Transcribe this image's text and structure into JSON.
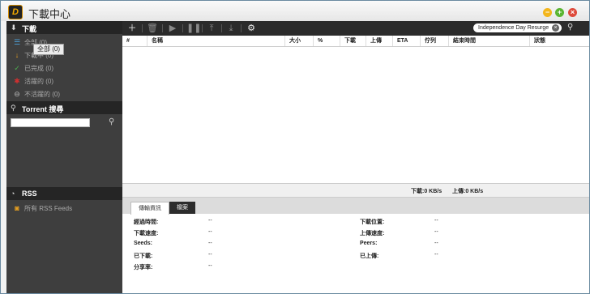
{
  "window": {
    "title": "下載中心",
    "app_icon_letter": "D",
    "controls": {
      "minimize": "−",
      "maximize": "+",
      "close": "×"
    }
  },
  "sidebar": {
    "download_header": "下載",
    "download_items": [
      {
        "label": "全部 (0)",
        "icon": "list-icon",
        "color": "#4da0d8"
      },
      {
        "label": "下載中 (0)",
        "icon": "download-arrow-icon",
        "color": "#e8a020"
      },
      {
        "label": "已完成 (0)",
        "icon": "checkmark-icon",
        "color": "#4cb050"
      },
      {
        "label": "活躍的 (0)",
        "icon": "active-icon",
        "color": "#d03030"
      },
      {
        "label": "不活躍的 (0)",
        "icon": "inactive-icon",
        "color": "#bbbbbb"
      }
    ],
    "tooltip": "全部 (0)",
    "search_header": "Torrent 搜尋",
    "search_value": "",
    "rss_header": "RSS",
    "rss_item": "所有 RSS Feeds"
  },
  "toolbar": {
    "search_value": "Independence Day Resurge",
    "buttons": [
      "add-icon",
      "delete-icon",
      "start-icon",
      "pause-icon",
      "move-top-icon",
      "move-bottom-icon",
      "settings-icon"
    ]
  },
  "table": {
    "columns": [
      "#",
      "名稱",
      "大小",
      "%",
      "下載",
      "上傳",
      "ETA",
      "佇列",
      "結束時間",
      "狀態"
    ]
  },
  "status": {
    "download_rate": "下載:0 KB/s",
    "upload_rate": "上傳:0 KB/s"
  },
  "details": {
    "tabs": [
      "傳輸資訊",
      "檔案"
    ],
    "left_fields": [
      {
        "label": "經過時間:",
        "value": "--"
      },
      {
        "label": "下載速度:",
        "value": "--"
      },
      {
        "label": "Seeds:",
        "value": "--"
      },
      {
        "label": "已下載:",
        "value": "--"
      },
      {
        "label": "分享率:",
        "value": "--"
      }
    ],
    "right_fields": [
      {
        "label": "下載位置:",
        "value": "--"
      },
      {
        "label": "上傳速度:",
        "value": "--"
      },
      {
        "label": "Peers:",
        "value": "--"
      },
      {
        "label": "已上傳:",
        "value": "--"
      }
    ]
  }
}
